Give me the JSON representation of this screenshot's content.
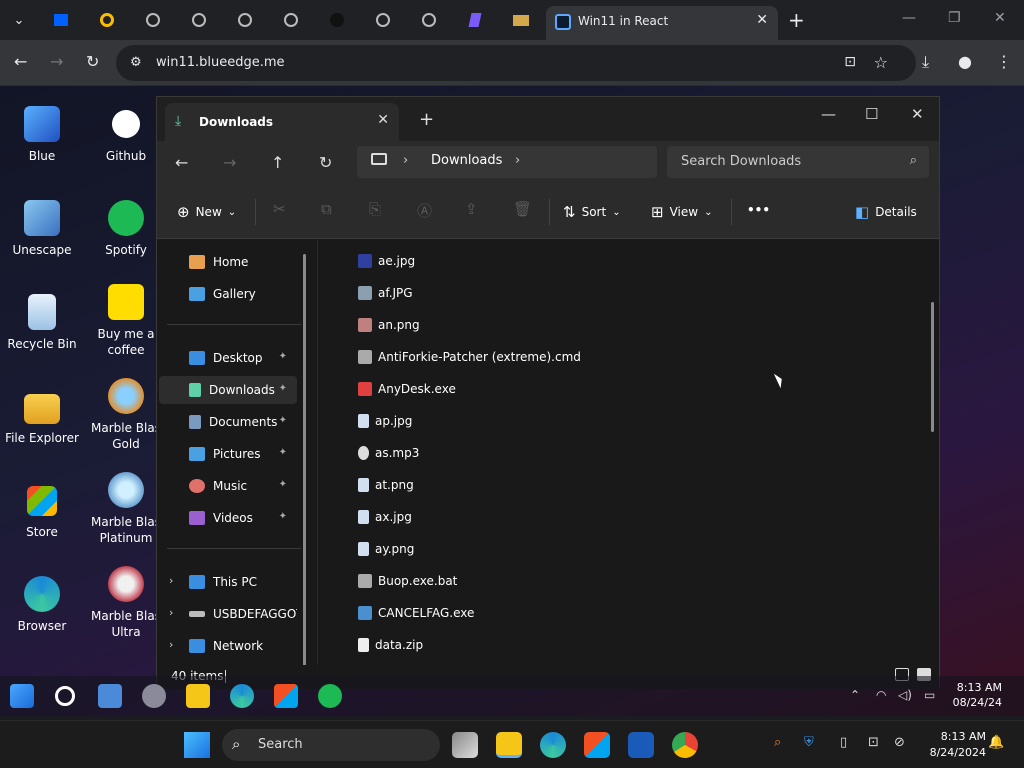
{
  "browser": {
    "active_tab_title": "Win11 in React",
    "url": "win11.blueedge.me",
    "new_tab_glyph": "+",
    "close_glyph": "✕",
    "minimize_glyph": "—",
    "maximize_glyph": "❐",
    "back_glyph": "←",
    "forward_glyph": "→",
    "reload_glyph": "↻",
    "bookmark_glyph": "☆",
    "download_glyph": "⤓",
    "profile_glyph": "●",
    "menu_glyph": "⋮",
    "install_glyph": "⊡",
    "tune_glyph": "⚙",
    "tab_menu_glyph": "⌄"
  },
  "desktop_icons": [
    {
      "label": "Blue",
      "color": "#3a7bd5"
    },
    {
      "label": "Github",
      "color": "#ffffff"
    },
    {
      "label": "Unescape",
      "color": "#5aa0e0"
    },
    {
      "label": "Spotify",
      "color": "#1db954"
    },
    {
      "label": "Recycle Bin",
      "color": "#bcd7f0"
    },
    {
      "label": "Buy me a",
      "label2": "coffee",
      "color": "#ffdd00"
    },
    {
      "label": "File Explorer",
      "color": "#f5c518"
    },
    {
      "label": "Marble Blas",
      "label2": "Gold",
      "color": "#e09030"
    },
    {
      "label": "Store",
      "color": "#2d6fd6"
    },
    {
      "label": "Marble Blas",
      "label2": "Platinum",
      "color": "#7ab0e0"
    },
    {
      "label": "Browser",
      "color": "#1a8ad8"
    },
    {
      "label": "Marble Blas",
      "label2": "Ultra",
      "color": "#c04050"
    }
  ],
  "explorer": {
    "tab_title": "Downloads",
    "tab_close": "✕",
    "new_tab": "+",
    "minimize": "—",
    "maximize": "☐",
    "close": "✕",
    "nav_back": "←",
    "nav_forward": "→",
    "nav_up": "↑",
    "nav_refresh": "↻",
    "breadcrumb": "Downloads",
    "chevron": "›",
    "search_placeholder": "Search Downloads",
    "search_glyph": "⌕",
    "commands": {
      "new": "New",
      "new_glyph": "⊕",
      "dropdown": "⌄",
      "sort": "Sort",
      "sort_glyph": "⇅",
      "view": "View",
      "view_glyph": "⊞",
      "more": "•••",
      "details": "Details",
      "details_glyph": "◧",
      "cut": "✂",
      "copy": "⧉",
      "paste": "⎘",
      "rename": "Ⓐ",
      "share": "⇪",
      "delete": "🗑"
    },
    "sidebar": [
      {
        "label": "Home",
        "color": "#e8a050",
        "pinned": false
      },
      {
        "label": "Gallery",
        "color": "#4aa0e0",
        "pinned": false
      },
      {
        "label": "Desktop",
        "color": "#3a8ee0",
        "pinned": true
      },
      {
        "label": "Downloads",
        "color": "#5fd0a8",
        "pinned": true,
        "selected": true
      },
      {
        "label": "Documents",
        "color": "#7a9ac0",
        "pinned": true
      },
      {
        "label": "Pictures",
        "color": "#4aa0e0",
        "pinned": true
      },
      {
        "label": "Music",
        "color": "#e0706a",
        "pinned": true
      },
      {
        "label": "Videos",
        "color": "#9a60d0",
        "pinned": true
      },
      {
        "label": "This PC",
        "color": "#3a8ee0",
        "expandable": true
      },
      {
        "label": "USBDEFAGGOT (",
        "color": "#bbbbbb",
        "expandable": true
      },
      {
        "label": "Network",
        "color": "#3a8ee0",
        "expandable": true
      }
    ],
    "pin_glyph": "📌",
    "expand_glyph": "›",
    "files": [
      {
        "name": "ae.jpg",
        "color": "#3040a0"
      },
      {
        "name": "af.JPG",
        "color": "#8aa0b0"
      },
      {
        "name": "an.png",
        "color": "#c08080"
      },
      {
        "name": "AntiForkie-Patcher (extreme).cmd",
        "color": "#aaaaaa"
      },
      {
        "name": "AnyDesk.exe",
        "color": "#e04040"
      },
      {
        "name": "ap.jpg",
        "color": "#d0e0f0"
      },
      {
        "name": "as.mp3",
        "color": "#dddddd"
      },
      {
        "name": "at.png",
        "color": "#d0e0f0"
      },
      {
        "name": "ax.jpg",
        "color": "#d0e0f0"
      },
      {
        "name": "ay.png",
        "color": "#d0e0f0"
      },
      {
        "name": "Buop.exe.bat",
        "color": "#aaaaaa"
      },
      {
        "name": "CANCELFAG.exe",
        "color": "#4a90d0"
      },
      {
        "name": "data.zip",
        "color": "#eeeeee"
      }
    ],
    "status_count": "40 items"
  },
  "inner_taskbar": {
    "time": "8:13 AM",
    "date": "08/24/24",
    "tray": [
      "⌃",
      "◠",
      "◁)",
      "▭"
    ]
  },
  "taskbar": {
    "start_glyph": "⊞",
    "search_glyph": "⌕",
    "search_placeholder": "Search",
    "time": "8:13 AM",
    "date": "8/24/2024",
    "tray": [
      "⌕",
      "⛨",
      "▯",
      "⊡",
      "⊘",
      "🔔"
    ]
  },
  "colors": {
    "accent": "#5fd0a8",
    "explorer_bg": "#191919",
    "cmdbar_bg": "#2b2b2b"
  }
}
